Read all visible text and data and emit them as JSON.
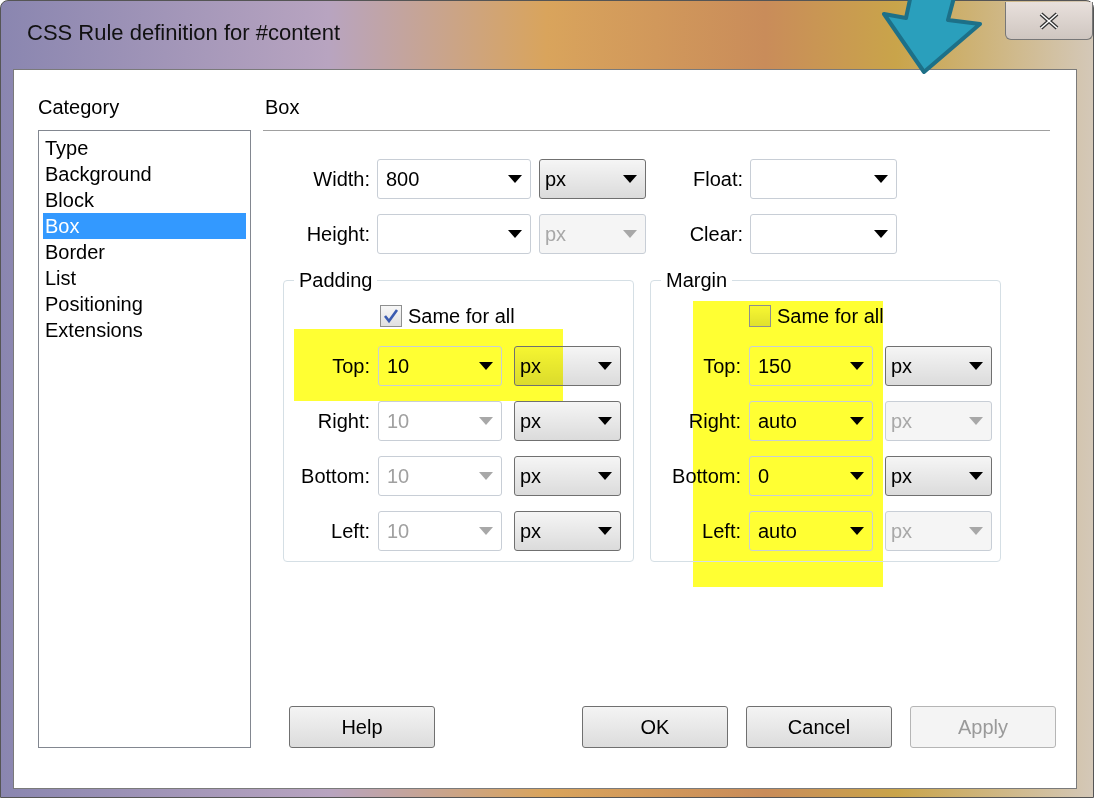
{
  "window": {
    "title": "CSS Rule definition for #content"
  },
  "category": {
    "label": "Category",
    "items": [
      {
        "label": "Type",
        "selected": false
      },
      {
        "label": "Background",
        "selected": false
      },
      {
        "label": "Block",
        "selected": false
      },
      {
        "label": "Box",
        "selected": true
      },
      {
        "label": "Border",
        "selected": false
      },
      {
        "label": "List",
        "selected": false
      },
      {
        "label": "Positioning",
        "selected": false
      },
      {
        "label": "Extensions",
        "selected": false
      }
    ]
  },
  "panel": {
    "title": "Box"
  },
  "size_fields": [
    {
      "label": "Width:",
      "value": "800",
      "unit": "px",
      "unit_disabled": false
    },
    {
      "label": "Height:",
      "unit": "px",
      "unit_disabled": true
    }
  ],
  "side_fields": [
    {
      "label": "Float:"
    },
    {
      "label": "Clear:"
    }
  ],
  "groups": [
    {
      "title": "Padding",
      "same_for_all": {
        "label": "Same for all",
        "checked": true
      },
      "rows": [
        {
          "label": "Top:",
          "value": "10",
          "disabled": false,
          "unit": "px",
          "unit_disabled": false
        },
        {
          "label": "Right:",
          "value": "10",
          "disabled": true,
          "unit": "px",
          "unit_disabled": false
        },
        {
          "label": "Bottom:",
          "value": "10",
          "disabled": true,
          "unit": "px",
          "unit_disabled": false
        },
        {
          "label": "Left:",
          "value": "10",
          "disabled": true,
          "unit": "px",
          "unit_disabled": false
        }
      ]
    },
    {
      "title": "Margin",
      "same_for_all": {
        "label": "Same for all",
        "checked": false
      },
      "rows": [
        {
          "label": "Top:",
          "value": "150",
          "disabled": false,
          "unit": "px",
          "unit_disabled": false
        },
        {
          "label": "Right:",
          "value": "auto",
          "disabled": false,
          "unit": "px",
          "unit_disabled": true
        },
        {
          "label": "Bottom:",
          "value": "0",
          "disabled": false,
          "unit": "px",
          "unit_disabled": false
        },
        {
          "label": "Left:",
          "value": "auto",
          "disabled": false,
          "unit": "px",
          "unit_disabled": true
        }
      ]
    }
  ],
  "buttons": [
    {
      "label": "Help",
      "disabled": false
    },
    {
      "label": "OK",
      "disabled": false
    },
    {
      "label": "Cancel",
      "disabled": false
    },
    {
      "label": "Apply",
      "disabled": true
    }
  ],
  "annotations": [
    {
      "kind": "highlight"
    },
    {
      "kind": "highlight"
    },
    {
      "kind": "arrow"
    }
  ]
}
